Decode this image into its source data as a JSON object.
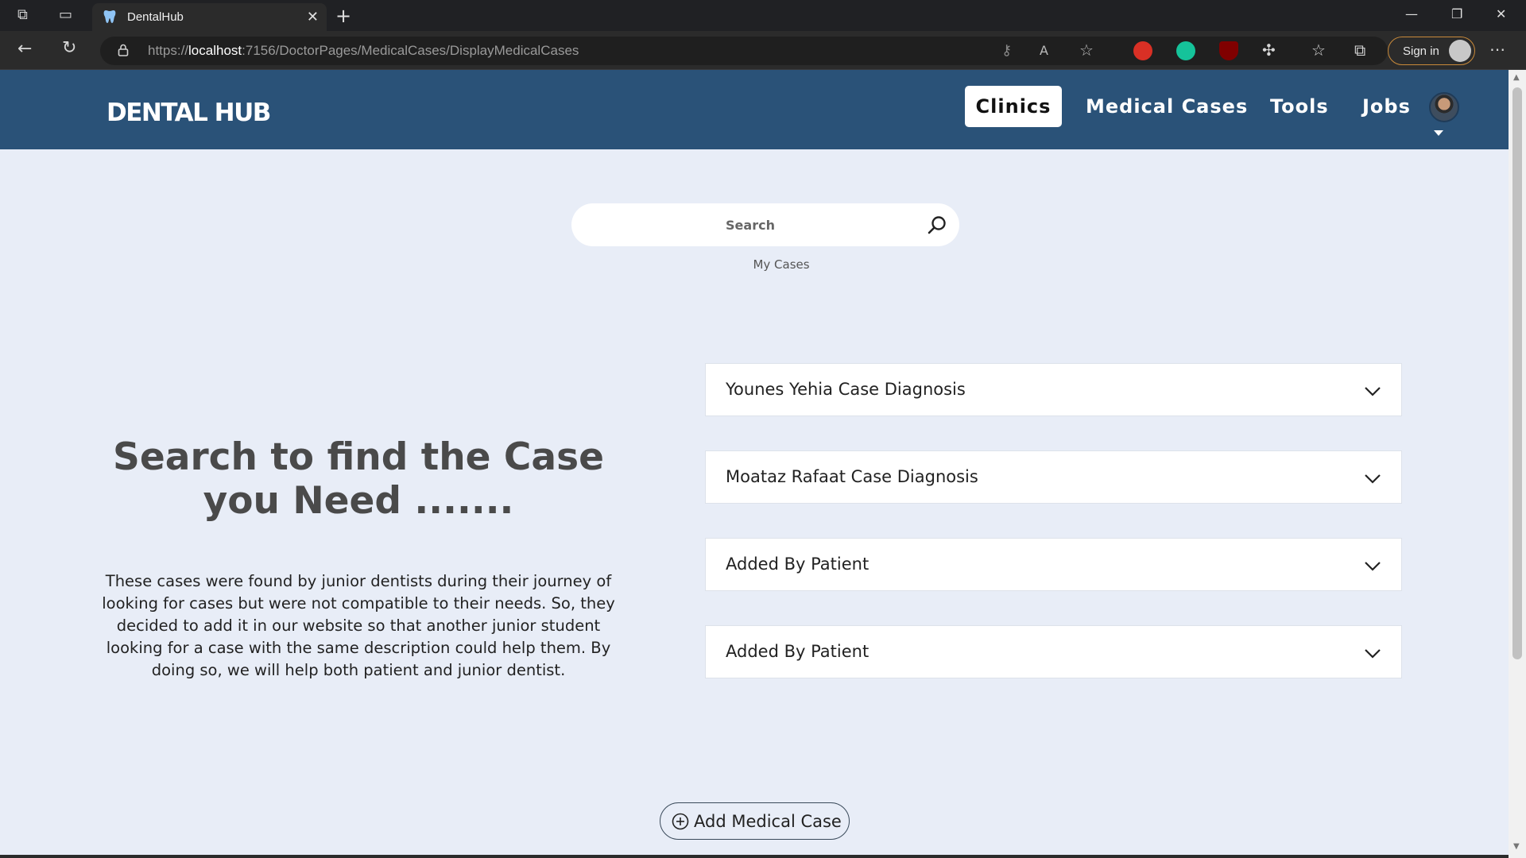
{
  "browser": {
    "tab_title": "DentalHub",
    "url_prefix": "https://",
    "url_host": "localhost",
    "url_path": ":7156/DoctorPages/MedicalCases/DisplayMedicalCases",
    "sign_in_label": "Sign in"
  },
  "header": {
    "logo": "DENTAL HUB",
    "nav": {
      "clinics": "Clinics",
      "medical_cases": "Medical Cases",
      "tools": "Tools",
      "jobs": "Jobs"
    }
  },
  "search": {
    "placeholder": "Search",
    "my_cases": "My Cases"
  },
  "intro": {
    "heading": "Search to find the Case you Need .......",
    "description": "These cases were found by junior dentists during their journey of looking for cases but were not compatible to their needs. So, they decided to add it in our website so that another junior student looking for a case with the same description could help them. By doing so, we will help both patient and junior dentist."
  },
  "cases": [
    {
      "title": "Younes Yehia Case Diagnosis"
    },
    {
      "title": "Moataz Rafaat Case Diagnosis"
    },
    {
      "title": "Added By Patient"
    },
    {
      "title": "Added By Patient"
    }
  ],
  "add_button": {
    "label": "Add Medical Case"
  },
  "colors": {
    "header_bg": "#2a5278",
    "page_bg": "#e8edf7",
    "heading_text": "#4a4a4a"
  }
}
